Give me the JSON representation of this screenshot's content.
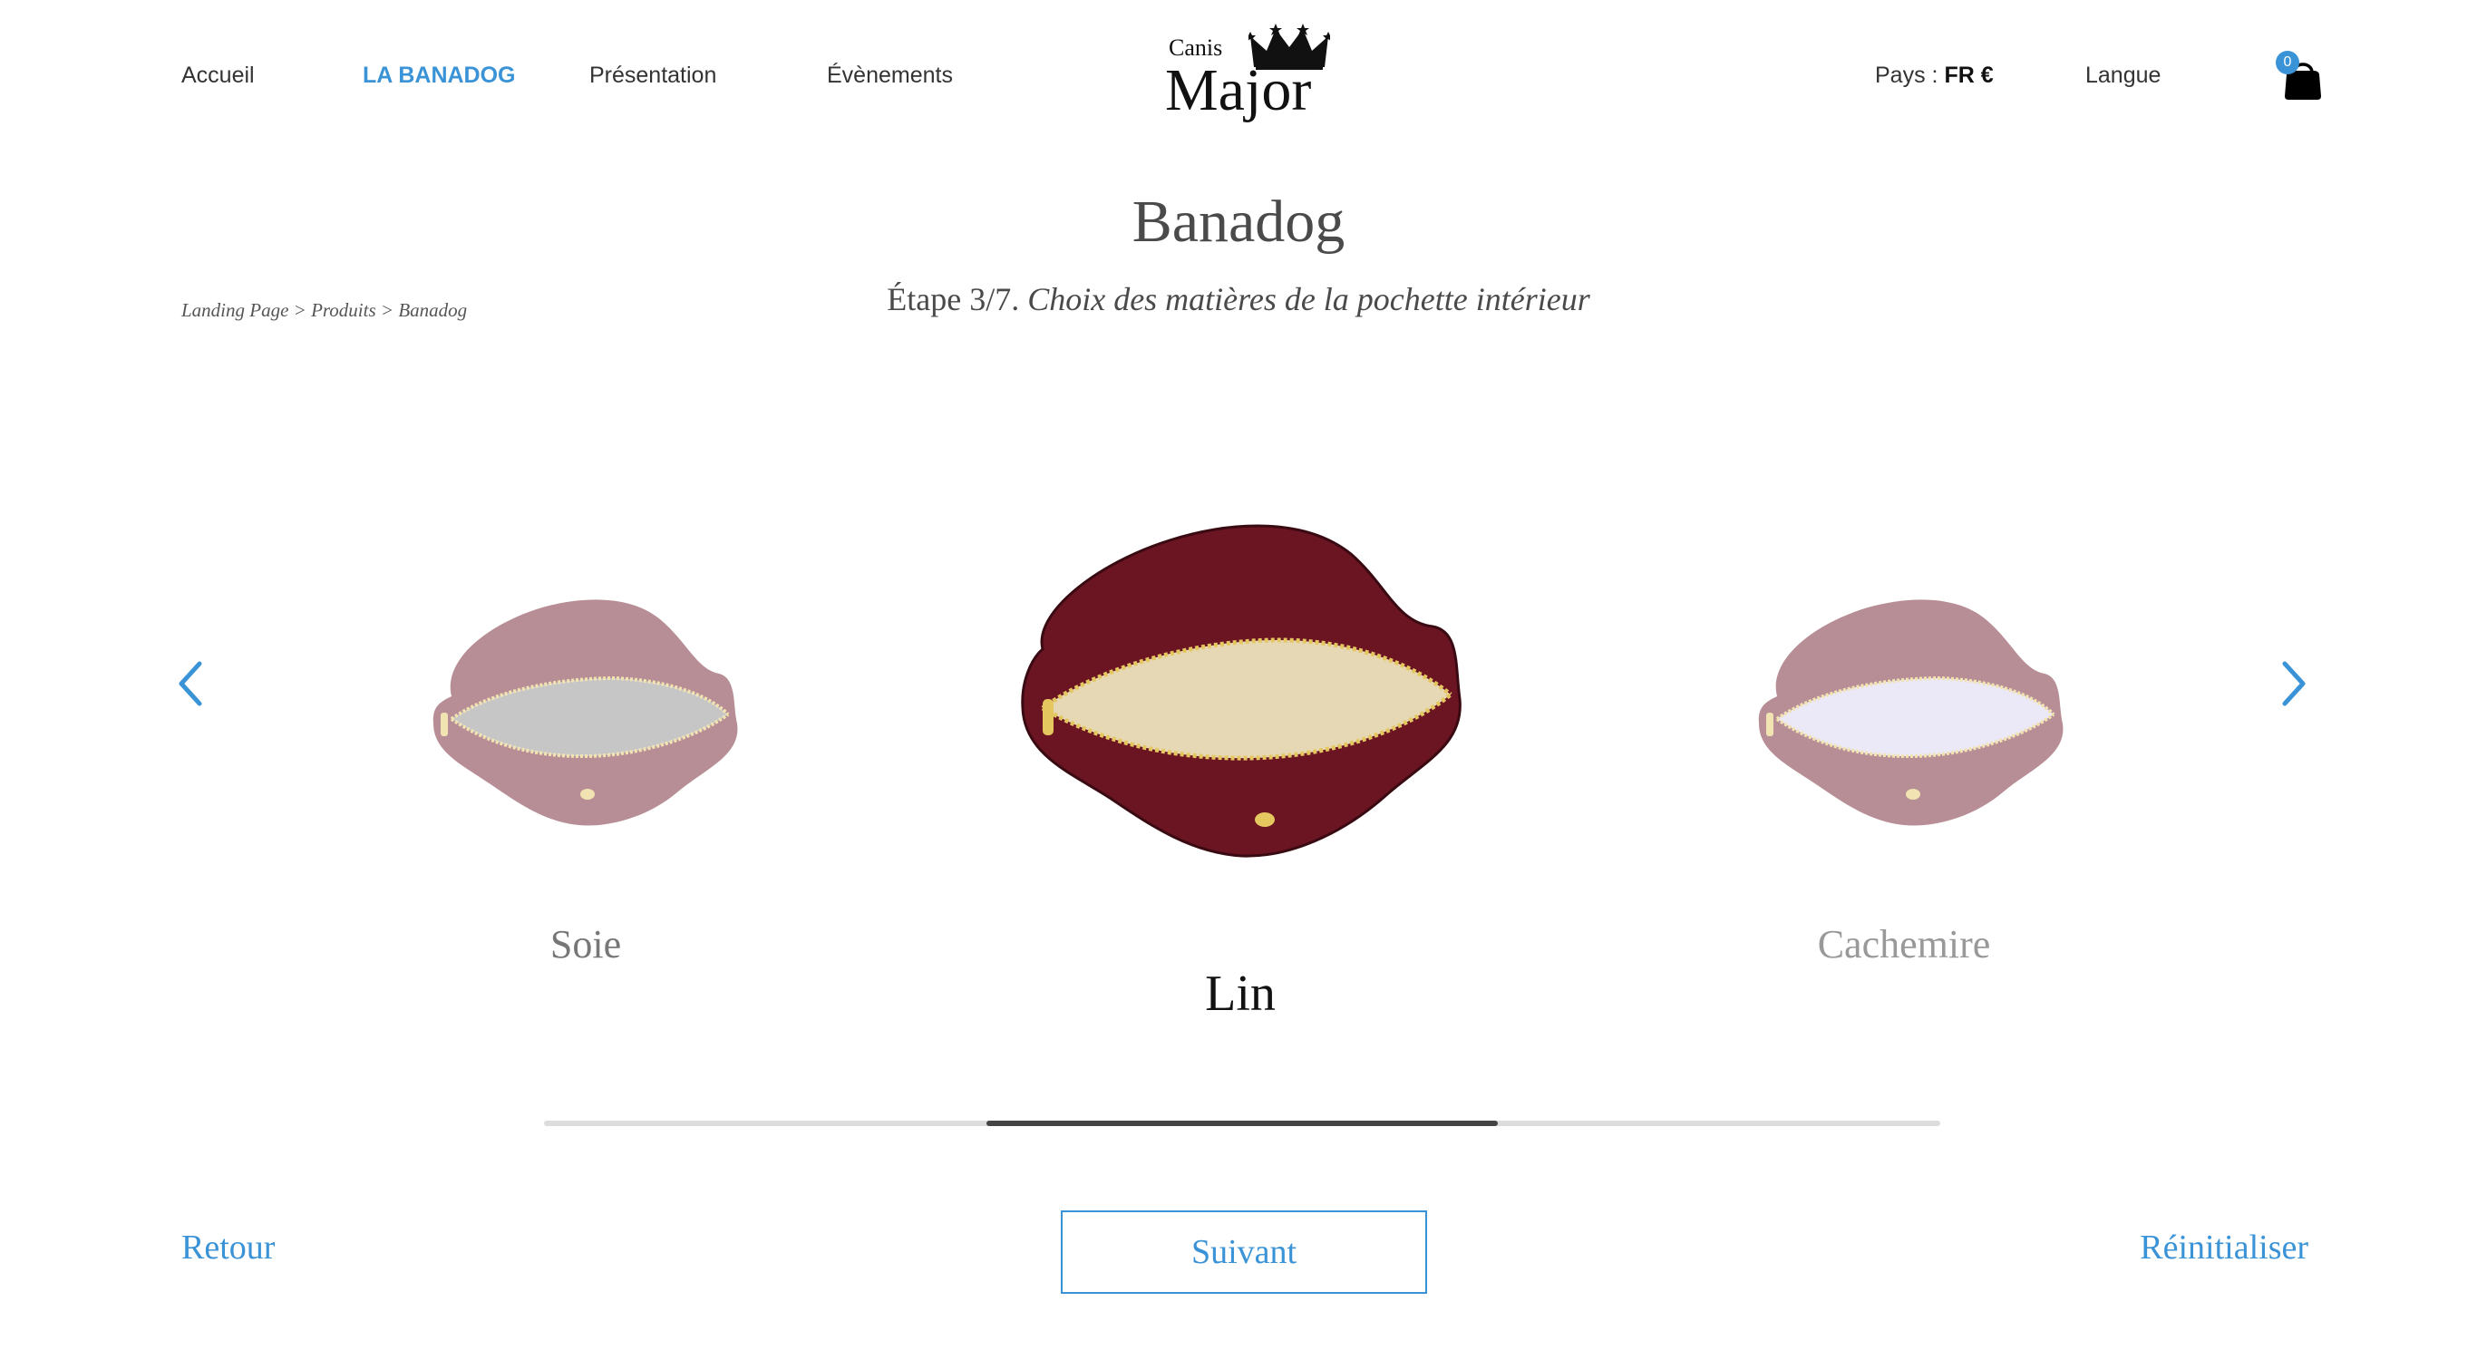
{
  "nav": {
    "home": "Accueil",
    "banadog": "LA BANADOG",
    "presentation": "Présentation",
    "events": "Évènements",
    "country_label": "Pays :",
    "country_value": "FR €",
    "language": "Langue",
    "cart_count": "0"
  },
  "logo": {
    "line1": "Canis",
    "line2": "Major"
  },
  "header": {
    "title": "Banadog",
    "step_number": "Étape 3/7.",
    "step_description": "Choix des matières de la pochette intérieur"
  },
  "breadcrumb": "Landing Page > Produits > Banadog",
  "carousel": {
    "options": [
      {
        "label": "Soie",
        "lining_color": "#8a8a8a",
        "selected": false
      },
      {
        "label": "Lin",
        "lining_color": "#e6d8b4",
        "selected": true
      },
      {
        "label": "Cachemire",
        "lining_color": "#d6d0ef",
        "selected": false
      }
    ],
    "body_color": "#6b1523",
    "zipper_color": "#e5c760",
    "accent_color": "#3a93d6",
    "scroll_position": {
      "start": 0.3167,
      "end": 0.6833
    }
  },
  "icons": {
    "prev": "chevron-left-icon",
    "next": "chevron-right-icon",
    "cart": "shopping-bag-icon",
    "crown": "crown-icon"
  },
  "footer": {
    "back": "Retour",
    "next": "Suivant",
    "reset": "Réinitialiser"
  }
}
